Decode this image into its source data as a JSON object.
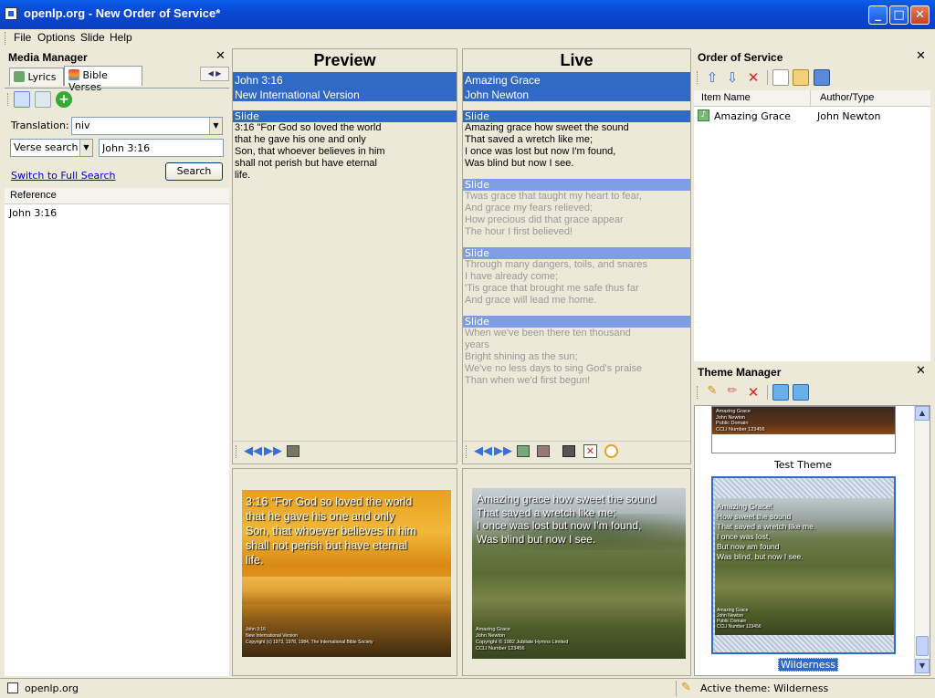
{
  "window": {
    "title": "openlp.org - New Order of Service*",
    "min": "_",
    "max": "□",
    "close": "✕"
  },
  "menu": [
    "File",
    "Options",
    "Slide",
    "Help"
  ],
  "media_manager": {
    "title": "Media Manager",
    "close": "✕",
    "tabs": [
      {
        "label": "Lyrics"
      },
      {
        "label": "Bible Verses",
        "active": true
      }
    ],
    "translation_label": "Translation:",
    "translation_value": "niv",
    "search_type": "Verse search",
    "search_value": "John 3:16",
    "search_button": "Search",
    "switch_link": "Switch to Full Search",
    "results_header": "Reference",
    "results": [
      "John 3:16"
    ]
  },
  "preview": {
    "title": "Preview",
    "header_lines": [
      "John 3:16",
      "New International Version"
    ],
    "slides": [
      {
        "label": "Slide",
        "text": "3:16 \"For God so loved the world\nthat he gave his one and only\nSon, that whoever believes in him\nshall not perish but have eternal\nlife."
      }
    ],
    "screen_text": "3:16 \"For God so loved the world\nthat he gave his one and only\nSon, that whoever believes in him\nshall not perish but have eternal\nlife.",
    "screen_footer": "John 3:16\nNew International Version\nCopyright (c) 1973, 1978, 1984, The International Bible Society"
  },
  "live": {
    "title": "Live",
    "header_lines": [
      "Amazing Grace",
      "John Newton"
    ],
    "slides": [
      {
        "label": "Slide",
        "text": "Amazing grace how sweet the sound\nThat saved a wretch like me;\nI once was lost but now I'm found,\nWas blind but now I see."
      },
      {
        "label": "Slide",
        "text": "Twas grace that taught my heart to fear,\nAnd grace my fears relieved;\nHow precious did that grace appear\nThe hour I first believed!"
      },
      {
        "label": "Slide",
        "text": "Through many dangers, toils, and snares\nI have already come;\n'Tis grace that brought me safe thus far\nAnd grace will lead me home."
      },
      {
        "label": "Slide",
        "text": "When we've been there ten thousand\nyears\nBright shining as the sun;\nWe've no less days to sing God's praise\nThan when we'd first begun!"
      }
    ],
    "screen_text": "Amazing grace how sweet the sound\nThat saved a wretch like me;\nI once was lost but now I'm found,\nWas blind but now I see.",
    "screen_footer": "Amazing Grace\nJohn Newton\nCopyright © 1982 Jubilate Hymns Limited\nCCLI Number 123456"
  },
  "order_of_service": {
    "title": "Order of Service",
    "close": "✕",
    "columns": [
      "Item Name",
      "Author/Type"
    ],
    "items": [
      {
        "name": "Amazing Grace",
        "author": "John Newton"
      }
    ]
  },
  "theme_manager": {
    "title": "Theme Manager",
    "close": "✕",
    "themes": [
      {
        "name": "Test Theme",
        "thumb_text": "Amazing Grace\nJohn Newton\nPublic Domain\nCCLI Number 123456"
      },
      {
        "name": "Wilderness",
        "selected": true,
        "thumb_text": "Amazing Grace!\nHow sweet the sound\nThat saved a wretch like me.\nI once was lost,\nBut now am found\nWas blind, but now I see.",
        "thumb_footer": "Amazing Grace\nJohn Newton\nPublic Domain\nCCLI Number 123456"
      }
    ]
  },
  "status": {
    "left": "openlp.org",
    "right": "Active theme: Wilderness"
  },
  "colors": {
    "selection": "#316ac5",
    "title_bar": "#0848d6",
    "background": "#ece9d8"
  }
}
